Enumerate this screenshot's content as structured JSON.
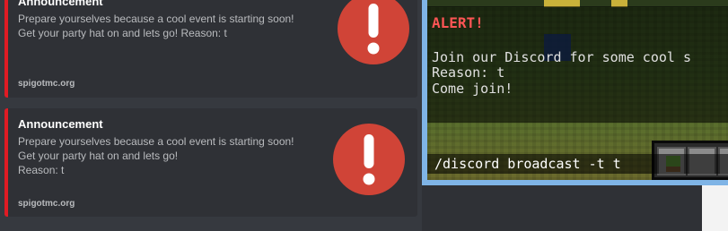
{
  "discord": {
    "embeds": [
      {
        "title": "Announcement",
        "description_lines": [
          "Prepare yourselves because a cool event is starting soon!",
          "Get your party hat on and lets go! Reason: t"
        ],
        "footer": "spigotmc.org",
        "icon": "alert-icon"
      },
      {
        "title": "Announcement",
        "description_lines": [
          "Prepare yourselves because a cool event is starting soon!",
          "Get your party hat on and lets go!",
          "Reason: t"
        ],
        "footer": "spigotmc.org",
        "icon": "alert-icon"
      }
    ],
    "colors": {
      "embed_border": "#e01b24",
      "alert_red": "#d04437",
      "background": "#36393f",
      "embed_bg": "#2f3136"
    }
  },
  "minecraft": {
    "alert_title": "ALERT!",
    "lines": [
      "Join our Discord for some cool s",
      "Reason: t",
      "Come join!"
    ],
    "chat_input": "/discord broadcast -t t",
    "colors": {
      "alert": "#ff5555",
      "text": "#e0e0e0",
      "window_frame": "#7fb4e6"
    }
  }
}
